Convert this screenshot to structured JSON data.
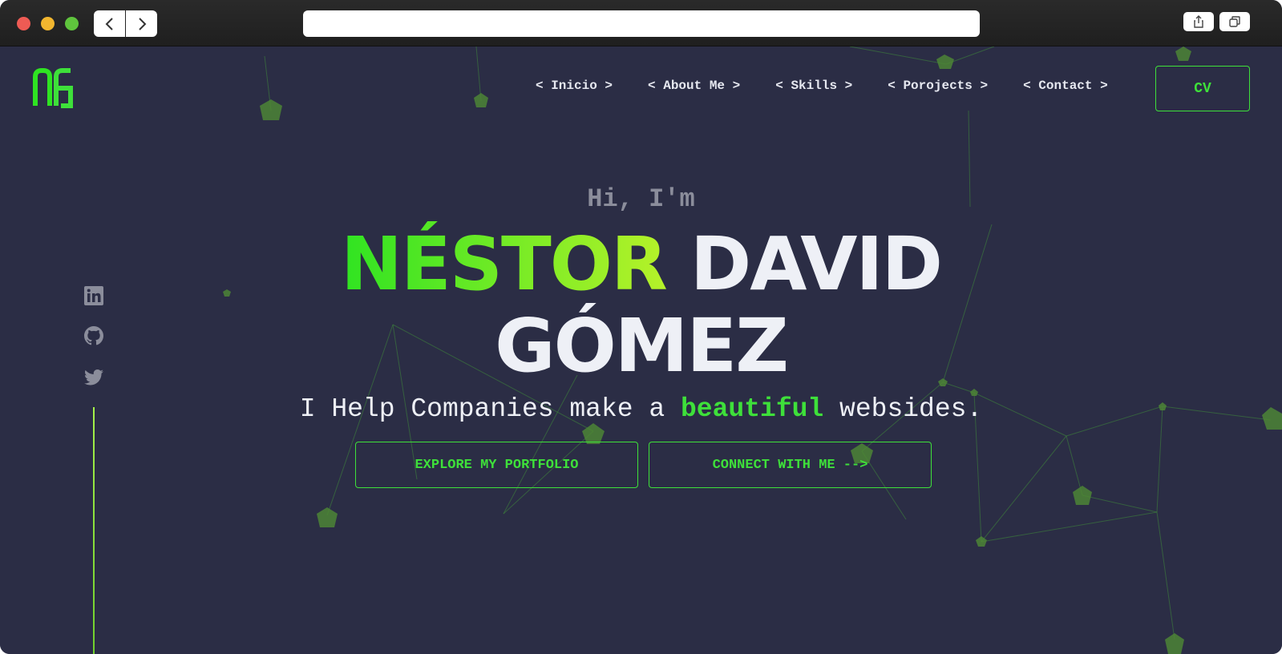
{
  "nav": {
    "items": [
      {
        "label": "< Inicio >"
      },
      {
        "label": "< About Me >"
      },
      {
        "label": "< Skills >"
      },
      {
        "label": "< Porojects >"
      },
      {
        "label": "< Contact >"
      }
    ],
    "cv_label": "CV"
  },
  "hero": {
    "greeting": "Hi, I'm",
    "name_first": "NÉSTOR",
    "name_middle": "DAVID",
    "name_last": "GÓMEZ",
    "tagline_before": "I Help Companies make a ",
    "tagline_highlight": "beautiful",
    "tagline_after": " websides.",
    "explore_label": "EXPLORE MY PORTFOLIO",
    "connect_label": "CONNECT WITH ME -->"
  },
  "social": {
    "icons": [
      "linkedin-icon",
      "github-icon",
      "twitter-icon"
    ]
  },
  "colors": {
    "accent": "#3ee03a",
    "accent_light": "#b6f229",
    "background": "#2b2d45",
    "text": "#eef0f6",
    "muted": "#8b8d9b"
  }
}
